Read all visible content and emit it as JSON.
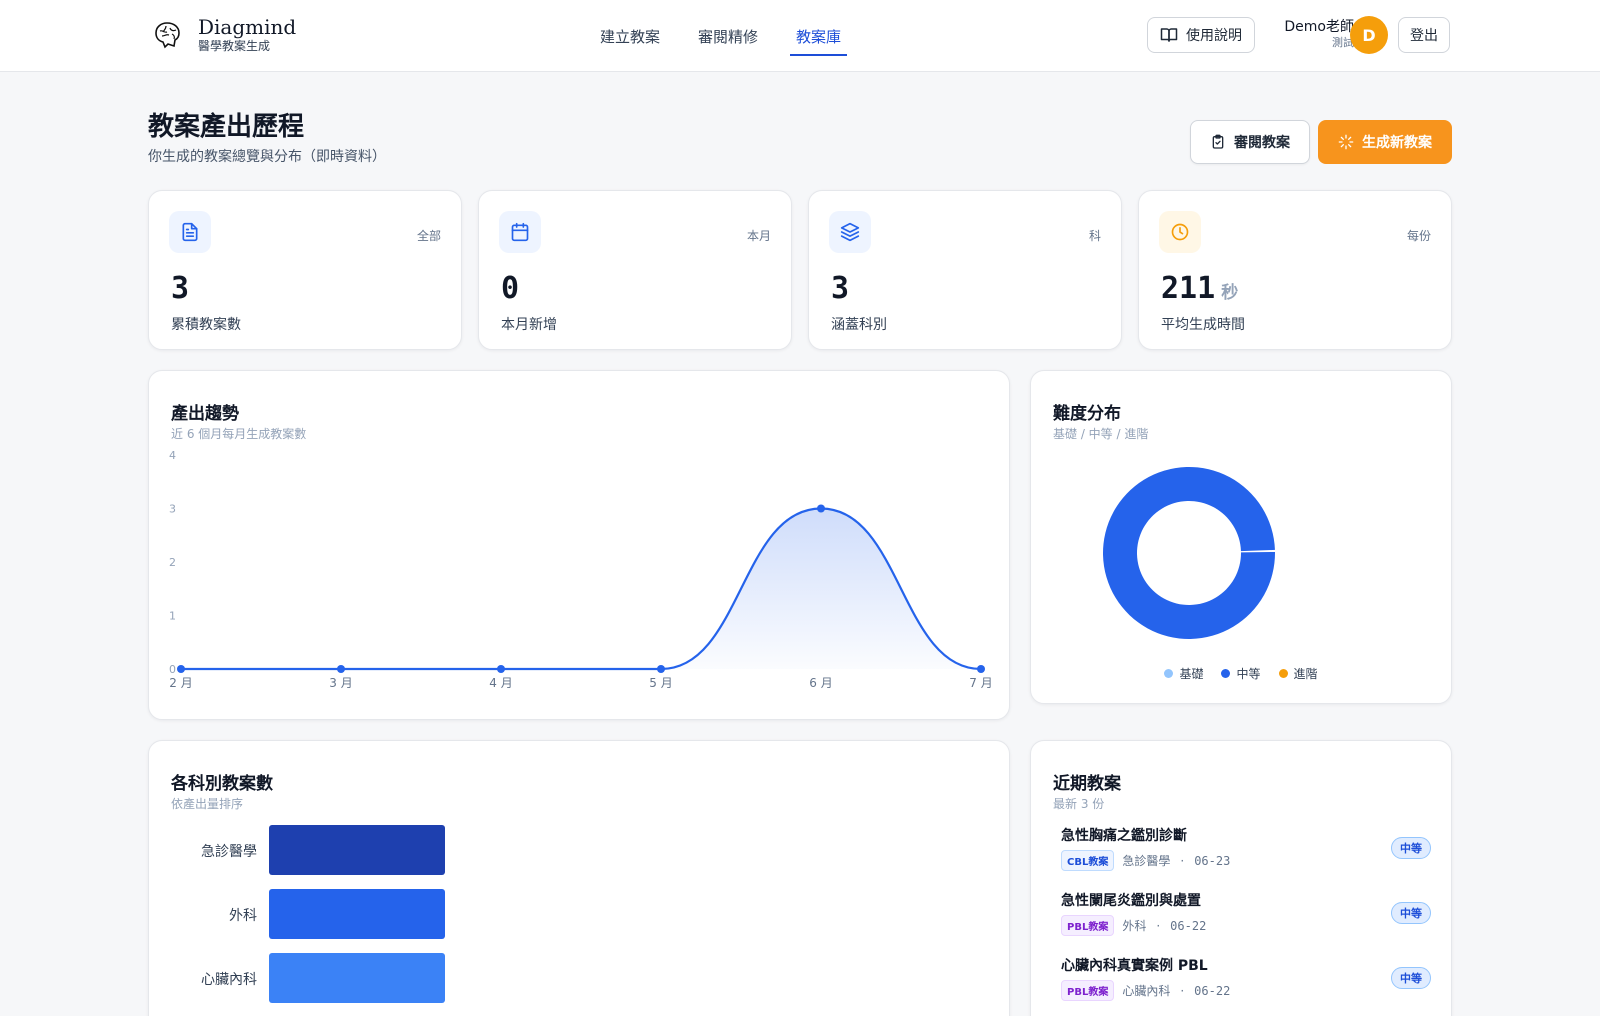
{
  "header": {
    "brand_name": "Diagmind",
    "brand_sub": "醫學教案生成",
    "nav": [
      "建立教案",
      "審閱精修",
      "教案庫"
    ],
    "help_label": "使用說明",
    "user_name": "Demo老師",
    "user_role": "測試",
    "avatar_letter": "D",
    "logout_label": "登出"
  },
  "page": {
    "title": "教案產出歷程",
    "subtitle": "你生成的教案總覽與分布（即時資料）",
    "review_label": "審閱教案",
    "generate_label": "生成新教案"
  },
  "stats": [
    {
      "icon": "document-icon",
      "tag": "全部",
      "value": "3",
      "unit": "",
      "label": "累積教案數",
      "color": "#2563eb",
      "bg": "#eef4ff"
    },
    {
      "icon": "calendar-icon",
      "tag": "本月",
      "value": "0",
      "unit": "",
      "label": "本月新增",
      "color": "#2563eb",
      "bg": "#eef4ff"
    },
    {
      "icon": "layers-icon",
      "tag": "科",
      "value": "3",
      "unit": "",
      "label": "涵蓋科別",
      "color": "#2563eb",
      "bg": "#eef4ff"
    },
    {
      "icon": "clock-icon",
      "tag": "每份",
      "value": "211",
      "unit": "秒",
      "label": "平均生成時間",
      "color": "#f59e0b",
      "bg": "#fff7e6"
    }
  ],
  "trend": {
    "title": "產出趨勢",
    "subtitle": "近 6 個月每月生成教案數"
  },
  "difficulty": {
    "title": "難度分布",
    "subtitle": "基礎 / 中等 / 進階"
  },
  "departments": {
    "title": "各科別教案數",
    "subtitle": "依產出量排序"
  },
  "recent": {
    "title": "近期教案",
    "subtitle": "最新 3 份",
    "items": [
      {
        "title": "急性胸痛之鑑別診斷",
        "type": "CBL教案",
        "type_kind": "cbl",
        "dept": "急診醫學",
        "sep": "·",
        "date": "06-23",
        "difficulty": "中等"
      },
      {
        "title": "急性闌尾炎鑑別與處置",
        "type": "PBL教案",
        "type_kind": "pbl",
        "dept": "外科",
        "sep": "·",
        "date": "06-22",
        "difficulty": "中等"
      },
      {
        "title": "心臟內科真實案例 PBL",
        "type": "PBL教案",
        "type_kind": "pbl",
        "dept": "心臟內科",
        "sep": "·",
        "date": "06-22",
        "difficulty": "中等"
      }
    ]
  },
  "colors": {
    "accent": "#1d4ed8",
    "orange": "#f7941d",
    "line": "#2563eb",
    "bar_colors": [
      "#1e40af",
      "#2563eb",
      "#3b82f6"
    ],
    "cbl_fg": "#1d4ed8",
    "cbl_bg": "#eef4ff",
    "pbl_fg": "#7e22ce",
    "pbl_bg": "#f5eeff"
  },
  "chart_data": [
    {
      "type": "area",
      "categories": [
        "2 月",
        "3 月",
        "4 月",
        "5 月",
        "6 月",
        "7 月"
      ],
      "values": [
        0,
        0,
        0,
        0,
        3,
        0
      ],
      "yticks": [
        "0",
        "1",
        "2",
        "3",
        "4"
      ],
      "ylim": [
        0,
        4
      ],
      "grid": false
    },
    {
      "type": "pie",
      "categories": [
        "基礎",
        "中等",
        "進階"
      ],
      "values": [
        0,
        3,
        0
      ],
      "colors": [
        "#93c5fd",
        "#2563eb",
        "#f59e0b"
      ],
      "legend": "bottom"
    },
    {
      "type": "bar",
      "orientation": "horizontal",
      "categories": [
        "急診醫學",
        "外科",
        "心臟內科"
      ],
      "values": [
        1,
        1,
        1
      ],
      "xlim": [
        0,
        5
      ]
    }
  ]
}
